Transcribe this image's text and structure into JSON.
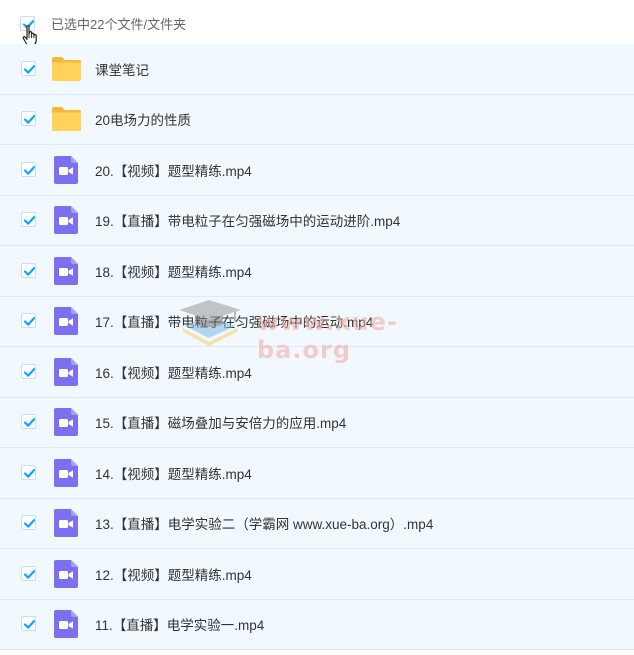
{
  "header": {
    "selection_label": "已选中22个文件/文件夹"
  },
  "files": [
    {
      "name": "课堂笔记",
      "icon": "folder-icon"
    },
    {
      "name": "20电场力的性质",
      "icon": "folder-icon"
    },
    {
      "name": "20.【视频】题型精练.mp4",
      "icon": "video-icon"
    },
    {
      "name": "19.【直播】带电粒子在匀强磁场中的运动进阶.mp4",
      "icon": "video-icon"
    },
    {
      "name": "18.【视频】题型精练.mp4",
      "icon": "video-icon"
    },
    {
      "name": "17.【直播】带电粒子在匀强磁场中的运动.mp4",
      "icon": "video-icon"
    },
    {
      "name": "16.【视频】题型精练.mp4",
      "icon": "video-icon"
    },
    {
      "name": "15.【直播】磁场叠加与安倍力的应用.mp4",
      "icon": "video-icon"
    },
    {
      "name": "14.【视频】题型精练.mp4",
      "icon": "video-icon"
    },
    {
      "name": "13.【直播】电学实验二（学霸网 www.xue-ba.org）.mp4",
      "icon": "video-icon"
    },
    {
      "name": "12.【视频】题型精练.mp4",
      "icon": "video-icon"
    },
    {
      "name": "11.【直播】电学实验一.mp4",
      "icon": "video-icon"
    }
  ],
  "watermark": {
    "text": "www.xue-ba.org"
  },
  "colors": {
    "accent": "#06a7ff",
    "row_bg": "#f1f8fe",
    "folder": "#ffc94c",
    "video": "#7c6ff0"
  }
}
